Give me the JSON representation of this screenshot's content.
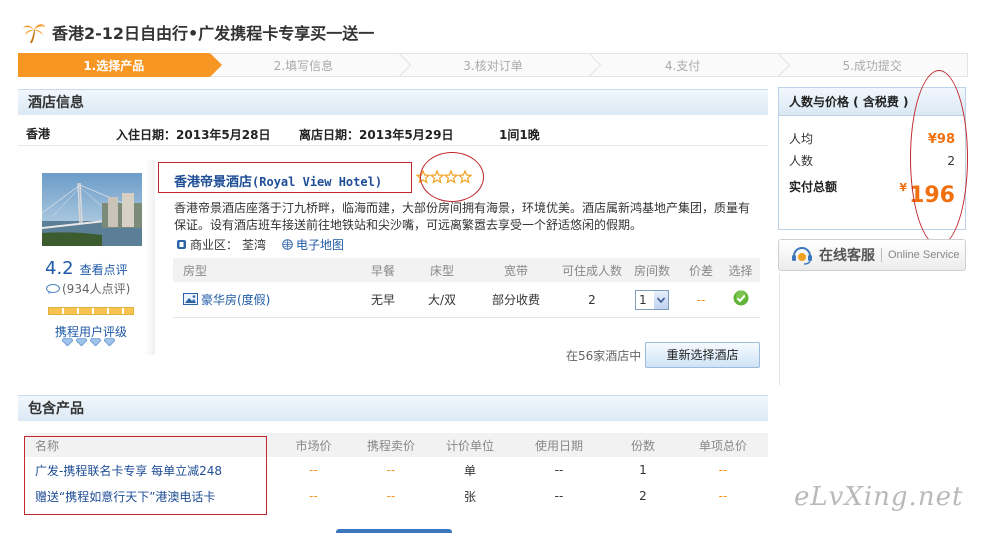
{
  "page": {
    "title": "香港2-12日自由行•广发携程卡专享买一送一"
  },
  "steps": [
    {
      "label": "1.选择产品",
      "active": true
    },
    {
      "label": "2.填写信息",
      "active": false
    },
    {
      "label": "3.核对订单",
      "active": false
    },
    {
      "label": "4.支付",
      "active": false
    },
    {
      "label": "5.成功提交",
      "active": false
    }
  ],
  "hotel_section": {
    "heading": "酒店信息",
    "city": "香港",
    "checkin_label": "入住日期：",
    "checkin_date": "2013年5月28日",
    "checkout_label": "离店日期：",
    "checkout_date": "2013年5月29日",
    "stay": "1间1晚"
  },
  "hotel": {
    "name_cn": "香港帝景酒店",
    "name_en": "(Royal View Hotel)",
    "star_rating": 4,
    "description": "香港帝景酒店座落于汀九桥畔，临海而建，大部份房间拥有海景，环境优美。酒店属新鸿基地产集团，质量有保证。设有酒店班车接送前往地铁站和尖沙嘴，可远离繁嚣去享受一个舒适悠闲的假期。",
    "district_label": "商业区：",
    "district": "荃湾",
    "map_link": "电子地图",
    "score": "4.2",
    "review_link": "查看点评",
    "review_count": "(934人点评)",
    "user_rating_label": "携程用户评级",
    "user_rating_diamonds": 4
  },
  "room_table": {
    "headers": [
      "房型",
      "早餐",
      "床型",
      "宽带",
      "可住成人数",
      "房间数",
      "价差",
      "选择"
    ],
    "rows": [
      {
        "name": "豪华房(度假)",
        "breakfast": "无早",
        "bed": "大/双",
        "broadband": "部分收费",
        "adults": "2",
        "rooms": "1",
        "diff": "--"
      }
    ],
    "hotel_count": "在56家酒店中",
    "reselect_button": "重新选择酒店"
  },
  "package_section": {
    "heading": "包含产品",
    "headers": [
      "名称",
      "市场价",
      "携程卖价",
      "计价单位",
      "使用日期",
      "份数",
      "单项总价"
    ],
    "rows": [
      {
        "name": "广发-携程联名卡专享 每单立减248",
        "market": "--",
        "price": "--",
        "unit": "单",
        "date": "--",
        "qty": "1",
        "total": "--"
      },
      {
        "name": "赠送“携程如意行天下”港澳电话卡",
        "market": "--",
        "price": "--",
        "unit": "张",
        "date": "--",
        "qty": "2",
        "total": "--"
      }
    ]
  },
  "price_box": {
    "heading": "人数与价格 ( 含税费 )",
    "per_person_label": "人均",
    "per_person_value": "¥98",
    "people_label": "人数",
    "people_value": "2",
    "total_label": "实付总额",
    "total_currency": "¥",
    "total_value": "196"
  },
  "service": {
    "cn": "在线客服",
    "en": "Online Service"
  },
  "watermark": "eLvXing.net",
  "colors": {
    "accent_orange": "#f79622",
    "link_blue": "#1f5aa6",
    "annotation_red": "#c0282e",
    "price_orange": "#f0700f"
  }
}
